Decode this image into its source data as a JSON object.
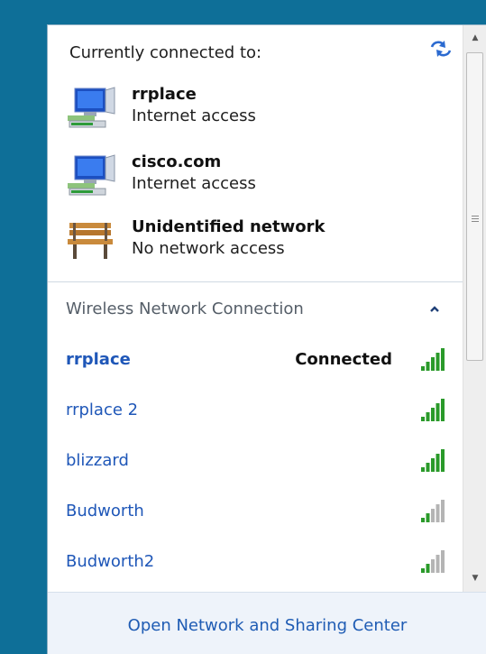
{
  "header": {
    "label": "Currently connected to:"
  },
  "connections": [
    {
      "name": "rrplace",
      "status": "Internet access",
      "icon": "network-computer-icon"
    },
    {
      "name": "cisco.com",
      "status": "Internet access",
      "icon": "network-computer-icon"
    },
    {
      "name": "Unidentified network",
      "status": "No network access",
      "icon": "park-bench-icon"
    }
  ],
  "wireless": {
    "title": "Wireless Network Connection",
    "networks": [
      {
        "ssid": "rrplace",
        "status": "Connected",
        "signal_bars": 5,
        "bold": true
      },
      {
        "ssid": "rrplace 2",
        "status": "",
        "signal_bars": 5
      },
      {
        "ssid": "blizzard",
        "status": "",
        "signal_bars": 5
      },
      {
        "ssid": "Budworth",
        "status": "",
        "signal_bars": 2
      },
      {
        "ssid": "Budworth2",
        "status": "",
        "signal_bars": 2
      }
    ]
  },
  "footer": {
    "link": "Open Network and Sharing Center"
  },
  "colors": {
    "accent": "#1f57b8",
    "signal_on": "#2a9a2a",
    "signal_off": "#b4b4b4",
    "desktop": "#0e6f98"
  }
}
